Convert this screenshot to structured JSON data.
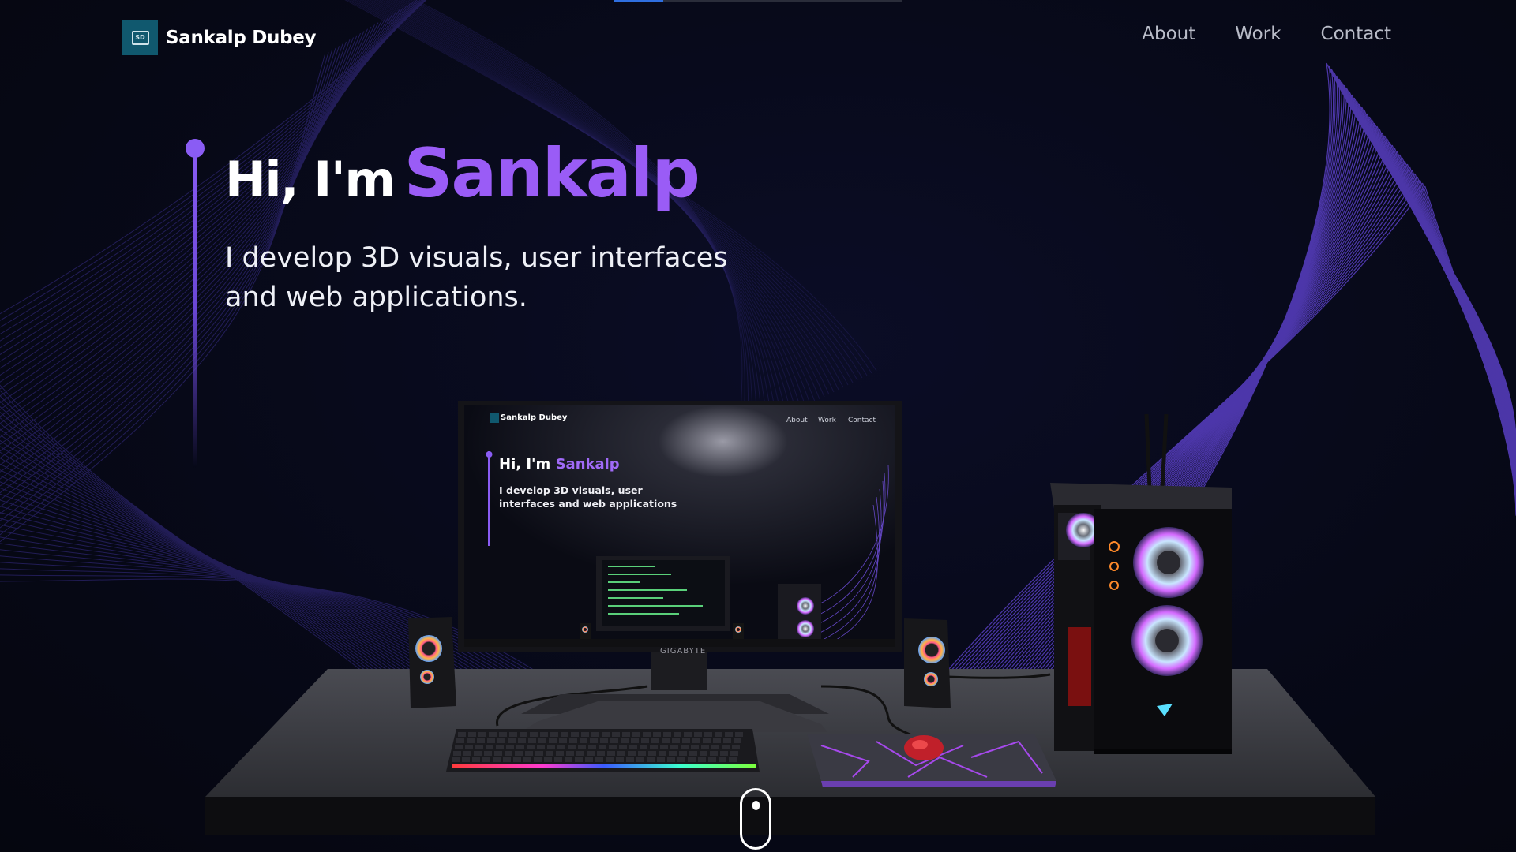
{
  "header": {
    "brand_name": "Sankalp Dubey",
    "logo_initials": "SD",
    "nav": [
      "About",
      "Work",
      "Contact"
    ]
  },
  "hero": {
    "greeting": "Hi, I'm",
    "name": "Sankalp",
    "subtitle": "I develop 3D visuals, user interfaces and web applications."
  },
  "scroll_progress": 0.17,
  "monitor_screen": {
    "brand_name": "Sankalp Dubey",
    "nav": [
      "About",
      "Work",
      "Contact"
    ],
    "greeting": "Hi, I'm",
    "name": "Sankalp",
    "subtitle": "I develop 3D visuals, user interfaces and web applications"
  },
  "monitor_brand": "GIGABYTE",
  "colors": {
    "background": "#070918",
    "accent": "#9a5cf6",
    "text": "#ffffff",
    "nav_text": "#b9bcc8",
    "logo_bg": "#10586e"
  }
}
